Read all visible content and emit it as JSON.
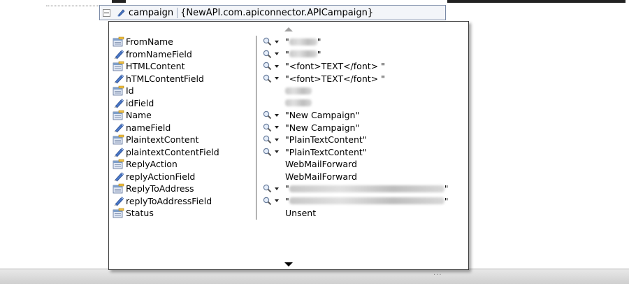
{
  "datatip": {
    "variable_name": "campaign",
    "type_text": "{NewAPI.com.apiconnector.APICampaign}"
  },
  "members": [
    {
      "name": "FromName",
      "kind": "property",
      "value": "",
      "redacted": true,
      "quoted": true,
      "visualizer": true
    },
    {
      "name": "fromNameField",
      "kind": "field",
      "value": "",
      "redacted": true,
      "quoted": true,
      "visualizer": true
    },
    {
      "name": "HTMLContent",
      "kind": "property",
      "value": "\"<font>TEXT</font> \"",
      "redacted": false,
      "quoted": false,
      "visualizer": true
    },
    {
      "name": "hTMLContentField",
      "kind": "field",
      "value": "\"<font>TEXT</font> \"",
      "redacted": false,
      "quoted": false,
      "visualizer": true
    },
    {
      "name": "Id",
      "kind": "property",
      "value": "",
      "redacted": true,
      "quoted": false,
      "visualizer": false
    },
    {
      "name": "idField",
      "kind": "field",
      "value": "",
      "redacted": true,
      "quoted": false,
      "visualizer": false
    },
    {
      "name": "Name",
      "kind": "property",
      "value": "\"New Campaign\"",
      "redacted": false,
      "quoted": false,
      "visualizer": true
    },
    {
      "name": "nameField",
      "kind": "field",
      "value": "\"New Campaign\"",
      "redacted": false,
      "quoted": false,
      "visualizer": true
    },
    {
      "name": "PlaintextContent",
      "kind": "property",
      "value": "\"PlainTextContent\"",
      "redacted": false,
      "quoted": false,
      "visualizer": true
    },
    {
      "name": "plaintextContentField",
      "kind": "field",
      "value": "\"PlainTextContent\"",
      "redacted": false,
      "quoted": false,
      "visualizer": true
    },
    {
      "name": "ReplyAction",
      "kind": "property",
      "value": "WebMailForward",
      "redacted": false,
      "quoted": false,
      "visualizer": false
    },
    {
      "name": "replyActionField",
      "kind": "field",
      "value": "WebMailForward",
      "redacted": false,
      "quoted": false,
      "visualizer": false
    },
    {
      "name": "ReplyToAddress",
      "kind": "property",
      "value": "",
      "redacted": true,
      "quoted": true,
      "visualizer": true
    },
    {
      "name": "replyToAddressField",
      "kind": "field",
      "value": "",
      "redacted": true,
      "quoted": true,
      "visualizer": true
    },
    {
      "name": "Status",
      "kind": "property",
      "value": "Unsent",
      "redacted": false,
      "quoted": false,
      "visualizer": false
    }
  ],
  "colors": {
    "property_icon_top": "#f0c040",
    "property_icon_body": "#7f9fc9",
    "field_icon": "#4a78c8",
    "header_bg": "#f3f5f9",
    "popup_border": "#3c3c3c"
  },
  "icons": {
    "property": "property-icon",
    "field": "field-icon",
    "visualizer": "magnifier-icon",
    "expander": "collapse-icon"
  }
}
